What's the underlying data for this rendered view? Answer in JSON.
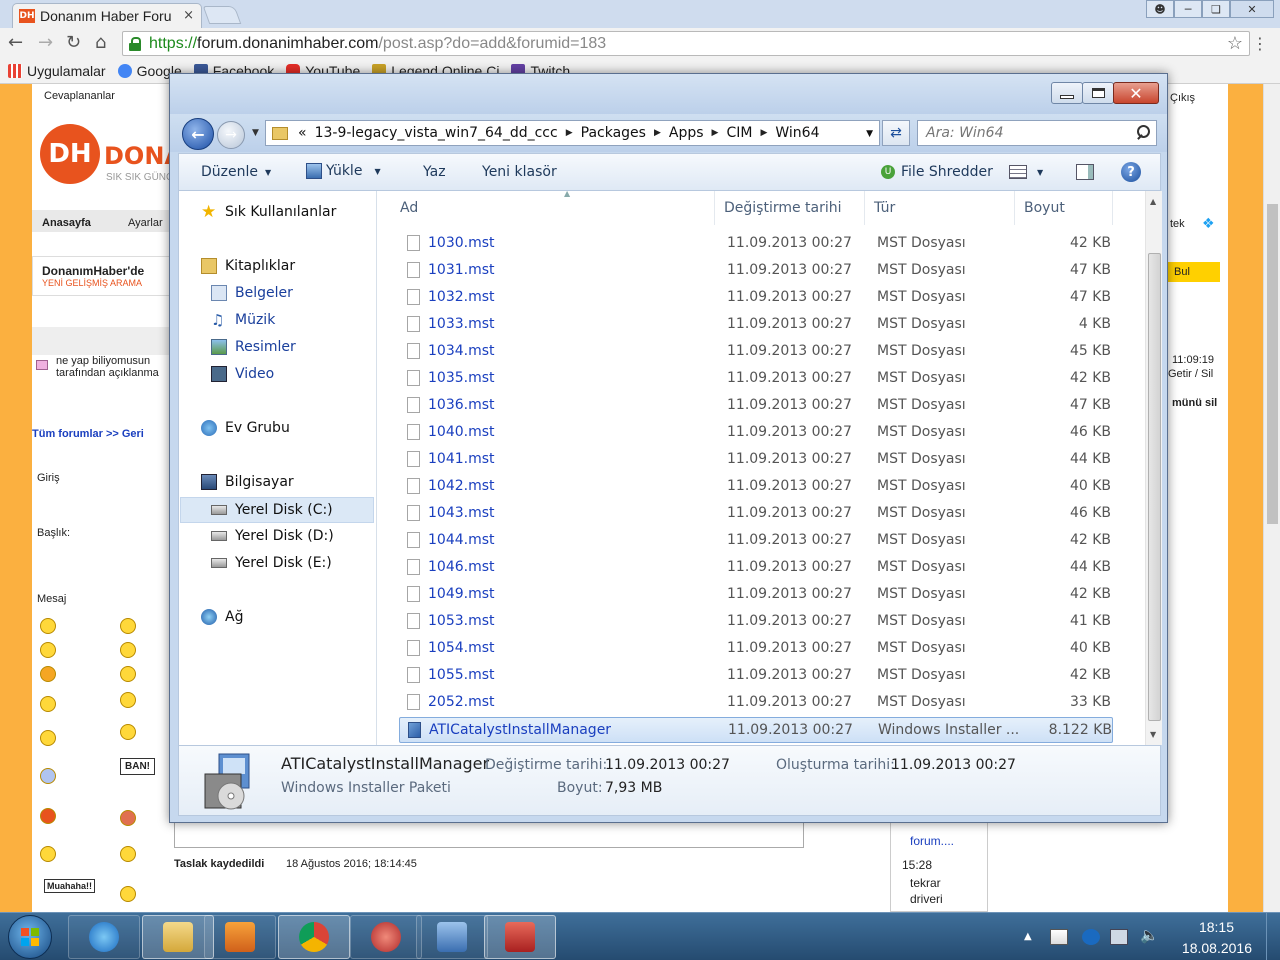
{
  "browser": {
    "tab_title": "Donanım Haber Foru",
    "tab_favicon_text": "DH",
    "tab_close": "×",
    "url": {
      "https": "https://",
      "host": "forum.donanimhaber.com",
      "path": "/post.asp?do=add&forumid=183"
    },
    "bookmarks": [
      {
        "label": "Uygulamalar",
        "color": "#e94235"
      },
      {
        "label": "Google",
        "color": "#4285f4"
      },
      {
        "label": "Facebook",
        "color": "#3b5998"
      },
      {
        "label": "YouTube",
        "color": "#e52d27"
      },
      {
        "label": "Legend Online Ci",
        "color": "#c9a227"
      },
      {
        "label": "Twitch",
        "color": "#6441a5"
      }
    ]
  },
  "page": {
    "cevaplananlar": "Cevaplananlar",
    "logo_letters": "DH",
    "logo_word": "DONAN",
    "slogan": "SIK SIK GÜNCE",
    "anasayfa": "Anasayfa",
    "ayarlar": "Ayarlar",
    "cikis": "Çıkış",
    "tek": "tek",
    "banner_title": "DonanımHaber'de",
    "banner_sub": "YENİ GELİŞMİŞ ARAMA",
    "bul": "Bul",
    "notice_line1": "ne yap biliyomusun",
    "notice_line2": "tarafından açıklanma",
    "time_right": "11:09:19",
    "getir_sil": "Getir / Sil",
    "menu_sil": "münü sil",
    "breadcrumb_forum": "Tüm forumlar >> Geri",
    "giris": "Giriş",
    "baslik": "Başlık:",
    "mesaj": "Mesaj",
    "ban_sign": "BAN!",
    "muahaha": "Muahaha!!",
    "draft_label": "Taslak kaydedildi",
    "draft_time": "18 Ağustos 2016; 18:14:45",
    "side_forum": "forum....",
    "side_time": "15:28",
    "side_tekrar": "tekrar",
    "side_driveri": "driveri"
  },
  "explorer": {
    "breadcrumb": [
      "13-9-legacy_vista_win7_64_dd_ccc",
      "Packages",
      "Apps",
      "CIM",
      "Win64"
    ],
    "breadcrumb_prefix": "«",
    "search_placeholder": "Ara: Win64",
    "commands": {
      "organize": "Düzenle",
      "upload": "Yükle",
      "write": "Yaz",
      "new_folder": "Yeni klasör",
      "file_shredder": "File Shredder"
    },
    "nav": {
      "favorites": "Sık Kullanılanlar",
      "libraries": "Kitaplıklar",
      "documents": "Belgeler",
      "music": "Müzik",
      "pictures": "Resimler",
      "video": "Video",
      "homegroup": "Ev Grubu",
      "computer": "Bilgisayar",
      "disk_c": "Yerel Disk (C:)",
      "disk_d": "Yerel Disk (D:)",
      "disk_e": "Yerel Disk (E:)",
      "network": "Ağ"
    },
    "columns": {
      "name": "Ad",
      "date": "Değiştirme tarihi",
      "type": "Tür",
      "size": "Boyut"
    },
    "files": [
      {
        "name": "1030.mst",
        "date": "11.09.2013 00:27",
        "type": "MST Dosyası",
        "size": "42 KB"
      },
      {
        "name": "1031.mst",
        "date": "11.09.2013 00:27",
        "type": "MST Dosyası",
        "size": "47 KB"
      },
      {
        "name": "1032.mst",
        "date": "11.09.2013 00:27",
        "type": "MST Dosyası",
        "size": "47 KB"
      },
      {
        "name": "1033.mst",
        "date": "11.09.2013 00:27",
        "type": "MST Dosyası",
        "size": "4 KB"
      },
      {
        "name": "1034.mst",
        "date": "11.09.2013 00:27",
        "type": "MST Dosyası",
        "size": "45 KB"
      },
      {
        "name": "1035.mst",
        "date": "11.09.2013 00:27",
        "type": "MST Dosyası",
        "size": "42 KB"
      },
      {
        "name": "1036.mst",
        "date": "11.09.2013 00:27",
        "type": "MST Dosyası",
        "size": "47 KB"
      },
      {
        "name": "1040.mst",
        "date": "11.09.2013 00:27",
        "type": "MST Dosyası",
        "size": "46 KB"
      },
      {
        "name": "1041.mst",
        "date": "11.09.2013 00:27",
        "type": "MST Dosyası",
        "size": "44 KB"
      },
      {
        "name": "1042.mst",
        "date": "11.09.2013 00:27",
        "type": "MST Dosyası",
        "size": "40 KB"
      },
      {
        "name": "1043.mst",
        "date": "11.09.2013 00:27",
        "type": "MST Dosyası",
        "size": "46 KB"
      },
      {
        "name": "1044.mst",
        "date": "11.09.2013 00:27",
        "type": "MST Dosyası",
        "size": "42 KB"
      },
      {
        "name": "1046.mst",
        "date": "11.09.2013 00:27",
        "type": "MST Dosyası",
        "size": "44 KB"
      },
      {
        "name": "1049.mst",
        "date": "11.09.2013 00:27",
        "type": "MST Dosyası",
        "size": "42 KB"
      },
      {
        "name": "1053.mst",
        "date": "11.09.2013 00:27",
        "type": "MST Dosyası",
        "size": "41 KB"
      },
      {
        "name": "1054.mst",
        "date": "11.09.2013 00:27",
        "type": "MST Dosyası",
        "size": "40 KB"
      },
      {
        "name": "1055.mst",
        "date": "11.09.2013 00:27",
        "type": "MST Dosyası",
        "size": "42 KB"
      },
      {
        "name": "2052.mst",
        "date": "11.09.2013 00:27",
        "type": "MST Dosyası",
        "size": "33 KB"
      },
      {
        "name": "ATICatalystInstallManager",
        "date": "11.09.2013 00:27",
        "type": "Windows Installer ...",
        "size": "8.122 KB"
      }
    ],
    "details": {
      "name": "ATICatalystInstallManager",
      "type": "Windows Installer Paketi",
      "modified_label": "Değiştirme tarihi:",
      "modified_value": "11.09.2013 00:27",
      "created_label": "Oluşturma tarihi:",
      "created_value": "11.09.2013 00:27",
      "size_label": "Boyut:",
      "size_value": "7,93 MB"
    }
  },
  "taskbar": {
    "time": "18:15",
    "date": "18.08.2016"
  }
}
